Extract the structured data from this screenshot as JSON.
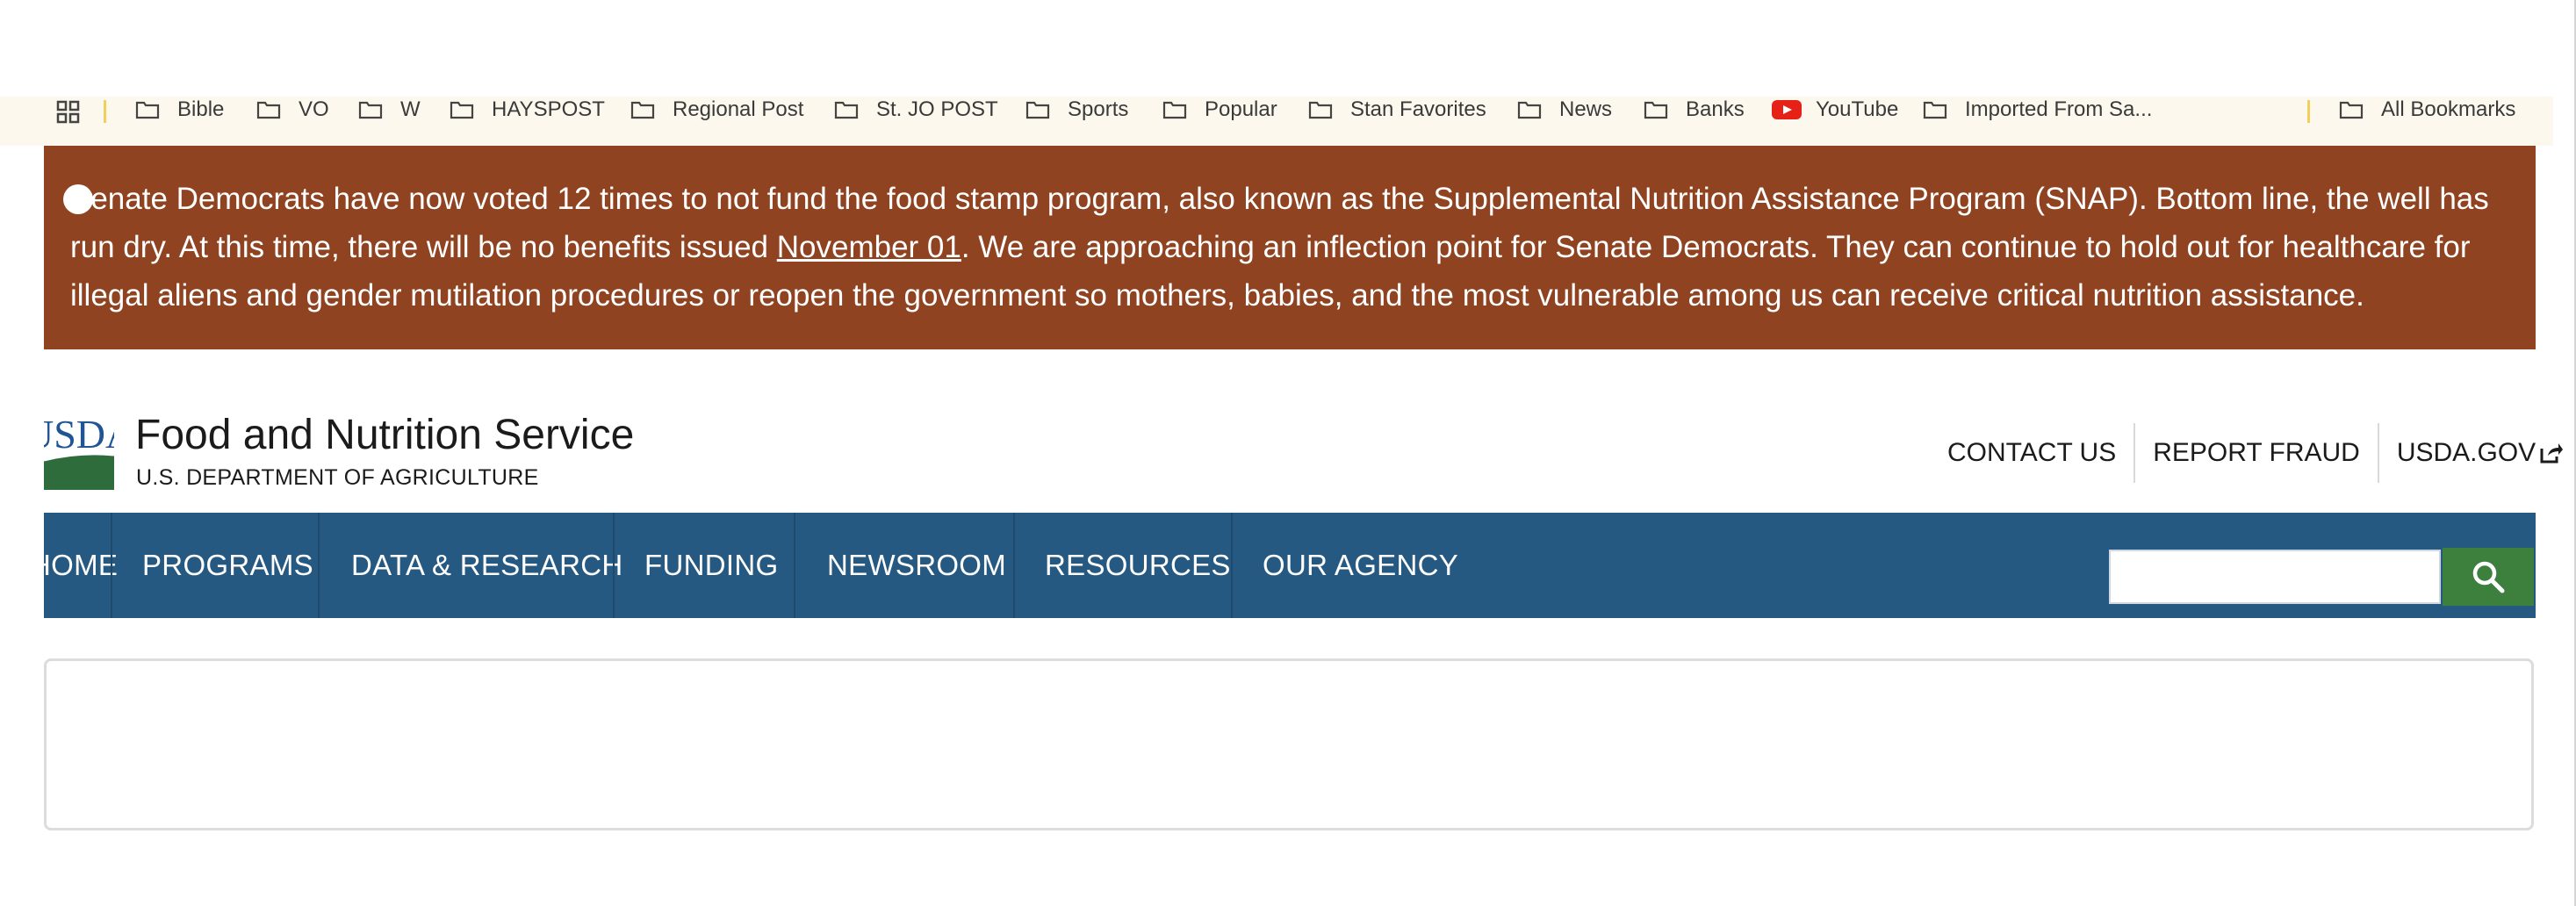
{
  "bookmarks": {
    "items": [
      {
        "label": "Bible",
        "icon": "folder-icon"
      },
      {
        "label": "VO",
        "icon": "folder-icon"
      },
      {
        "label": "W",
        "icon": "folder-icon"
      },
      {
        "label": "HAYSPOST",
        "icon": "folder-icon"
      },
      {
        "label": "Regional Post",
        "icon": "folder-icon"
      },
      {
        "label": "St. JO POST",
        "icon": "folder-icon"
      },
      {
        "label": "Sports",
        "icon": "folder-icon"
      },
      {
        "label": "Popular",
        "icon": "folder-icon"
      },
      {
        "label": "Stan Favorites",
        "icon": "folder-icon"
      },
      {
        "label": "News",
        "icon": "folder-icon"
      },
      {
        "label": "Banks",
        "icon": "folder-icon"
      },
      {
        "label": "YouTube",
        "icon": "youtube-icon"
      },
      {
        "label": "Imported From Sa...",
        "icon": "folder-icon"
      }
    ],
    "all_bookmarks": "All Bookmarks"
  },
  "alert": {
    "text_before": "Senate Democrats have now voted 12 times to not fund the food stamp program, also known as the Supplemental Nutrition Assistance Program (SNAP). Bottom line, the well has run dry. At this time, there will be no benefits issued ",
    "date_link": "November 01",
    "text_after": ". We are approaching an inflection point for Senate Democrats. They can continue to hold out for healthcare for illegal aliens and gender mutilation procedures or reopen the government so mothers, babies, and the most vulnerable among us can receive critical nutrition assistance."
  },
  "header": {
    "logo_text": "USDA",
    "title": "Food and Nutrition Service",
    "subtitle": "U.S. DEPARTMENT OF AGRICULTURE",
    "utility_links": [
      "CONTACT US",
      "REPORT FRAUD",
      "USDA.GOV"
    ]
  },
  "nav": {
    "items": [
      "HOME",
      "PROGRAMS",
      "DATA & RESEARCH",
      "FUNDING",
      "NEWSROOM",
      "RESOURCES",
      "OUR AGENCY"
    ],
    "search_placeholder": ""
  },
  "colors": {
    "alert_bg": "#8f4321",
    "nav_bg": "#255982",
    "search_button": "#3d7f3d",
    "bookmarks_bg": "#fdf8ed"
  }
}
